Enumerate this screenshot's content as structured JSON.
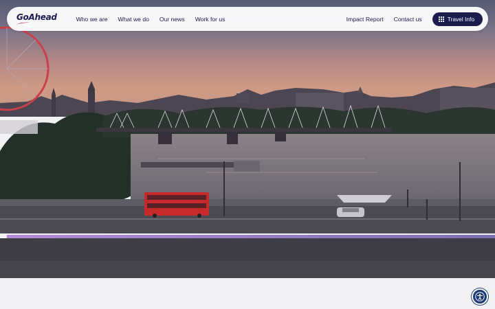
{
  "brand": {
    "logo_text": "GoAhead"
  },
  "nav": {
    "left_links": [
      "Who we are",
      "What we do",
      "Our news",
      "Work for us"
    ],
    "right_links": [
      "Impact Report",
      "Contact us"
    ],
    "cta_label": "Travel Info",
    "cta_icon": "grid-icon"
  },
  "hero": {
    "media": "aerial-video-river-bridge-sunset"
  },
  "accessibility": {
    "icon": "accessibility-icon"
  },
  "colors": {
    "brand_navy": "#1c1a52",
    "logo_red": "#d9262c",
    "cta_bg": "#1b1c4d",
    "a11y_bg": "#1d3c75",
    "page_bg": "#f2f2f4"
  }
}
